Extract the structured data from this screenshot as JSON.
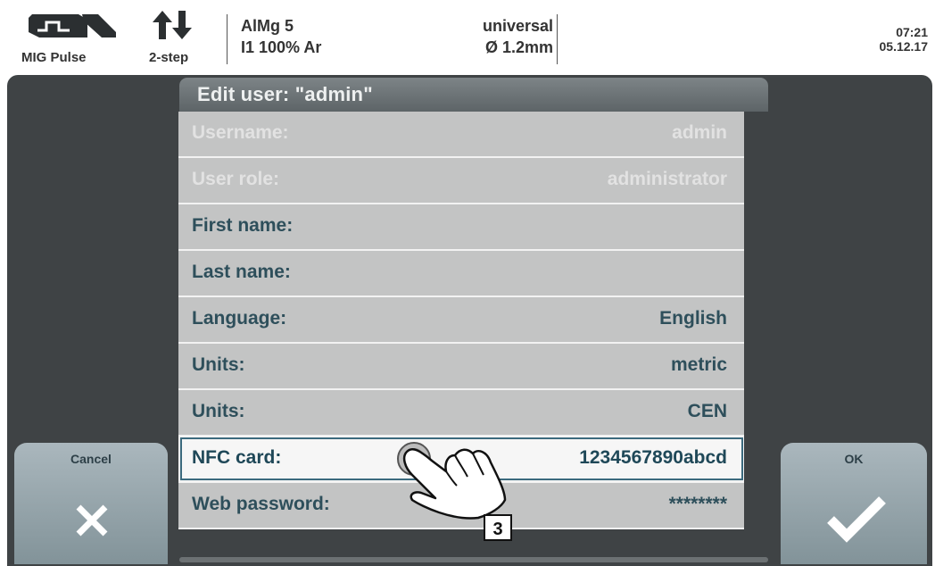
{
  "status": {
    "mode_icon": "mig-pulse-waveform-icon",
    "mode_label": "MIG Pulse",
    "step_icon": "up-down-arrows-icon",
    "step_label": "2-step",
    "material_line1": "AlMg 5",
    "material_line2": "I1 100% Ar",
    "wire_line1": "universal",
    "wire_line2": "Ø  1.2mm",
    "time": "07:21",
    "date": "05.12.17"
  },
  "dialog": {
    "title": "Edit user: \"admin\""
  },
  "rows": [
    {
      "label": "Username:",
      "value": "admin",
      "state": "disabled"
    },
    {
      "label": "User role:",
      "value": "administrator",
      "state": "disabled"
    },
    {
      "label": "First name:",
      "value": "",
      "state": "normal"
    },
    {
      "label": "Last name:",
      "value": "",
      "state": "normal"
    },
    {
      "label": "Language:",
      "value": "English",
      "state": "normal"
    },
    {
      "label": "Units:",
      "value": "metric",
      "state": "normal"
    },
    {
      "label": "Units:",
      "value": "CEN",
      "state": "normal"
    },
    {
      "label": "NFC card:",
      "value": "1234567890abcd",
      "state": "selected"
    },
    {
      "label": "Web password:",
      "value": "********",
      "state": "normal"
    }
  ],
  "buttons": {
    "cancel_label": "Cancel",
    "cancel_icon": "close-x-icon",
    "ok_label": "OK",
    "ok_icon": "checkmark-icon"
  },
  "callout": {
    "number": "3",
    "icon": "hand-pointer-icon"
  },
  "colors": {
    "panel": "#3f4345",
    "row": "#c3c4c4",
    "row_text": "#2e4f5b",
    "selected_border": "#3b6a7e",
    "button": "#8fa1a8"
  }
}
